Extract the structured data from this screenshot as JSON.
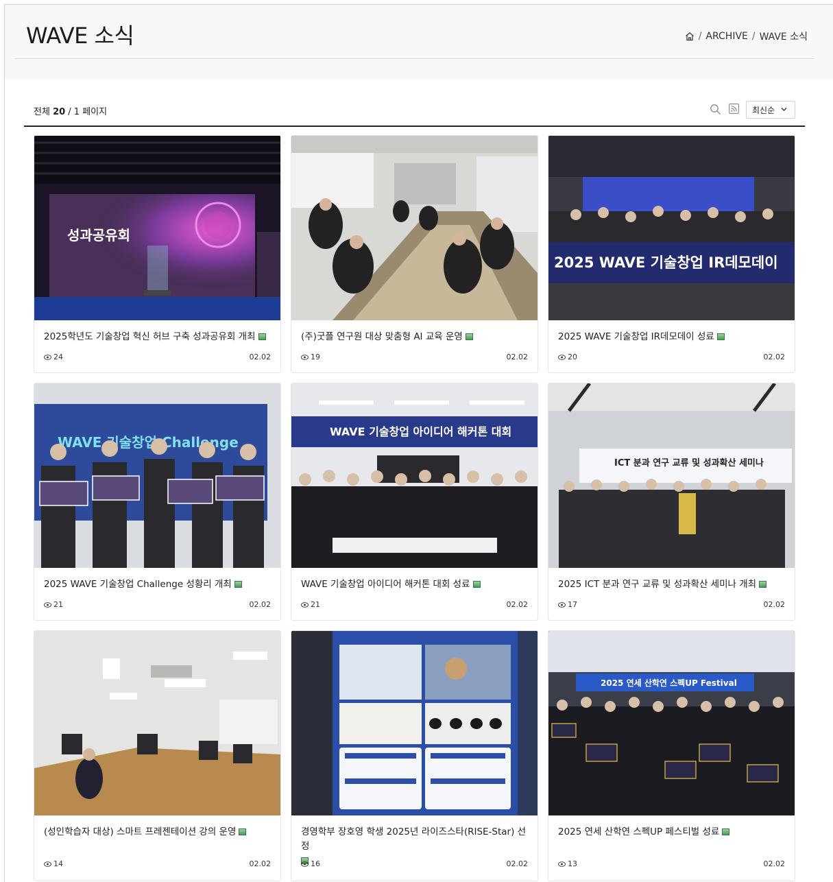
{
  "header": {
    "title": "WAVE 소식",
    "breadcrumb": [
      "ARCHIVE",
      "WAVE 소식"
    ],
    "breadcrumb_sep": "/"
  },
  "toolbar": {
    "count_prefix": "전체",
    "count_total": "20",
    "count_suffix": "/ 1 페이지",
    "sort_selected": "최신순"
  },
  "posts": [
    {
      "title": "2025학년도 기술창업 혁신 허브 구축 성과공유회 개최",
      "views": "24",
      "date": "02.02",
      "thumb_text": "성과공유회"
    },
    {
      "title": "(주)굿플 연구원 대상 맞춤형 AI 교육 운영",
      "views": "19",
      "date": "02.02",
      "thumb_text": ""
    },
    {
      "title": "2025 WAVE 기술창업 IR데모데이 성료",
      "views": "20",
      "date": "02.02",
      "thumb_text": "2025 WAVE 기술창업 IR데모데이"
    },
    {
      "title": "2025 WAVE 기술창업 Challenge 성황리 개최",
      "views": "21",
      "date": "02.02",
      "thumb_text": "WAVE 기술창업 Challenge"
    },
    {
      "title": "WAVE 기술창업 아이디어 해커톤 대회 성료",
      "views": "21",
      "date": "02.02",
      "thumb_text": "WAVE 기술창업 아이디어 해커톤 대회"
    },
    {
      "title": "2025 ICT 분과 연구 교류 및 성과확산 세미나 개최",
      "views": "17",
      "date": "02.02",
      "thumb_text": "ICT 분과 연구 교류 및 성과확산 세미나"
    },
    {
      "title": "(성인학습자 대상) 스마트 프레젠테이션 강의 운영",
      "views": "14",
      "date": "02.02",
      "thumb_text": ""
    },
    {
      "title": "경영학부 장호영 학생 2025년 라이즈스타(RISE-Star) 선정",
      "views": "16",
      "date": "02.02",
      "thumb_text": ""
    },
    {
      "title": "2025 연세 산학연 스펙UP 페스티벌 성료",
      "views": "13",
      "date": "02.02",
      "thumb_text": "2025 연세 산학연 스펙UP Festival"
    }
  ],
  "colors": {
    "accent_line": "#222222",
    "header_bg": "#f7f8fa",
    "image_icon": "#4a9a55"
  }
}
